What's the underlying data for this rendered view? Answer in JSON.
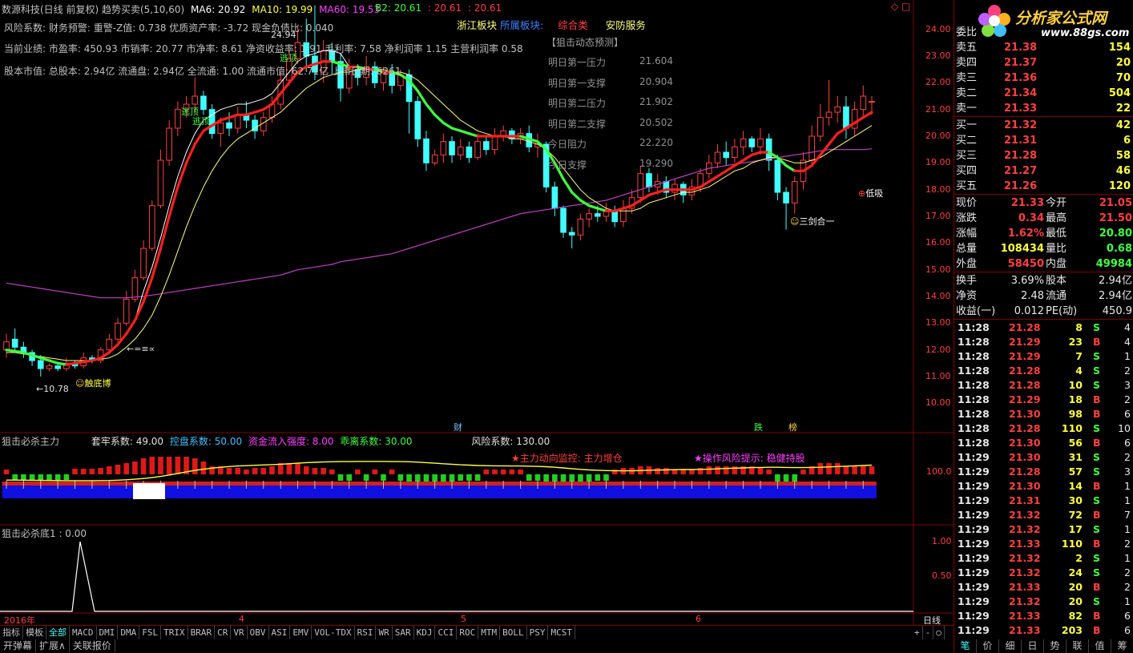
{
  "header": {
    "title": "数源科技(日线 前复权) 趋势买卖(5,10,60)",
    "ma6_label": "MA6: 20.92",
    "ma10_label": "MA10: 19.99",
    "ma60_label": "MA60: 19.53",
    "b2_label": "B2: 20.61",
    "b2_v2": ": 20.61",
    "b2_v3": ": 20.61",
    "region_label": "浙江板块",
    "sector_label": "所属板块:",
    "sector_value": "综合类",
    "sector_value2": "安防服务"
  },
  "info_lines": {
    "risk": "风险系数: 财务预警: 重警-Z值: 0.738 优质资产率: -3.72 现金负债比: 0.040",
    "perf": "当前业绩: 市盈率: 450.93 市销率: 20.77 市净率: 8.61 净资收益率: 1.91 毛利率: 7.58 净利润率 1.15 主营利润率 0.58",
    "cap": "股本市值: 总股本: 2.94亿 流通盘: 2.94亿 全流通: 1.00 流通市值: 62.71亿 上市日期: 6261"
  },
  "forecast": {
    "title": "【狙击动态预测】",
    "rows": [
      {
        "label": "明日第一压力",
        "value": "21.604"
      },
      {
        "label": "明日第一支撑",
        "value": "20.904"
      },
      {
        "label": "明日第二压力",
        "value": "21.902"
      },
      {
        "label": "明日第二支撑",
        "value": "20.502"
      },
      {
        "label": "今日阻力",
        "value": "22.220"
      },
      {
        "label": "今日支撑",
        "value": "19.290"
      }
    ]
  },
  "annotations": {
    "high_price": "24.94",
    "low_price": "←10.78",
    "escape_top": "逃顶",
    "bottom_buy": "低吸",
    "sword": "三剑合一",
    "bottom_fight": "触底博",
    "arrow_label": "←=≡∝",
    "marker_cai": "财",
    "marker_die": "跌",
    "marker_bang": "榜"
  },
  "price_axis": {
    "ticks": [
      "24.00",
      "23.00",
      "22.00",
      "21.00",
      "20.00",
      "19.00",
      "18.00",
      "17.00",
      "16.00",
      "15.00",
      "14.00",
      "13.00",
      "12.00",
      "11.00",
      "10.00"
    ]
  },
  "indicator1": {
    "title": "狙击必杀主力",
    "p1": "套牢系数: 49.00",
    "p2": "控盘系数: 50.00",
    "p3": "资金流入强度: 8.00",
    "p4": "乖离系数: 30.00",
    "p5": "风险系数: 130.00",
    "note1": "★主力动向监控: 主力增仓",
    "note2": "★操作风险提示: 稳健持股",
    "axis_value": "100.0"
  },
  "indicator2": {
    "title": "狙击必杀底1 : 0.00",
    "axis_top": "1.00",
    "axis_mid": "0.50"
  },
  "time_axis": {
    "labels": [
      "2016年",
      "4",
      "5",
      "6"
    ],
    "period": "日线"
  },
  "tabs": [
    "指标",
    "模板",
    "全部",
    "MACD",
    "DMI",
    "DMA",
    "FSL",
    "TRIX",
    "BRAR",
    "CR",
    "VR",
    "OBV",
    "ASI",
    "EMV",
    "VOL-TDX",
    "RSI",
    "WR",
    "SAR",
    "KDJ",
    "CCI",
    "ROC",
    "MTM",
    "BOLL",
    "PSY",
    "MCST"
  ],
  "tab_controls": [
    "+",
    "-",
    "○"
  ],
  "bottom_buttons": [
    "开弹幕",
    "扩展∧",
    "关联报价"
  ],
  "logo": {
    "text": "分析家公式网",
    "url": "www.88gs.com"
  },
  "quote": {
    "entrust_label": "委比",
    "asks": [
      {
        "label": "卖五",
        "price": "21.38",
        "vol": "154"
      },
      {
        "label": "卖四",
        "price": "21.37",
        "vol": "20"
      },
      {
        "label": "卖三",
        "price": "21.36",
        "vol": "70"
      },
      {
        "label": "卖二",
        "price": "21.34",
        "vol": "504"
      },
      {
        "label": "卖一",
        "price": "21.33",
        "vol": "22"
      }
    ],
    "bids": [
      {
        "label": "买一",
        "price": "21.32",
        "vol": "42"
      },
      {
        "label": "买二",
        "price": "21.31",
        "vol": "6"
      },
      {
        "label": "买三",
        "price": "21.28",
        "vol": "58"
      },
      {
        "label": "买四",
        "price": "21.27",
        "vol": "46"
      },
      {
        "label": "买五",
        "price": "21.26",
        "vol": "120"
      }
    ],
    "stats": [
      {
        "l1": "现价",
        "v1": "21.33",
        "c1": "up",
        "l2": "今开",
        "v2": "21.05",
        "c2": "up"
      },
      {
        "l1": "涨跌",
        "v1": "0.34",
        "c1": "up",
        "l2": "最高",
        "v2": "21.50",
        "c2": "up"
      },
      {
        "l1": "涨幅",
        "v1": "1.62%",
        "c1": "up",
        "l2": "最低",
        "v2": "20.80",
        "c2": "dn"
      },
      {
        "l1": "总量",
        "v1": "108434",
        "c1": "ye",
        "l2": "量比",
        "v2": "0.68",
        "c2": "dn"
      },
      {
        "l1": "外盘",
        "v1": "58450",
        "c1": "up",
        "l2": "内盘",
        "v2": "49984",
        "c2": "dn"
      }
    ],
    "stats2": [
      {
        "l1": "换手",
        "v1": "3.69%",
        "l2": "股本",
        "v2": "2.94亿"
      },
      {
        "l1": "净资",
        "v1": "2.48",
        "l2": "流通",
        "v2": "2.94亿"
      },
      {
        "l1": "收益(一)",
        "v1": "0.012",
        "l2": "PE(动)",
        "v2": "450.9"
      }
    ],
    "ticks": [
      {
        "t": "11:28",
        "p": "21.28",
        "v": "8",
        "s": "S",
        "n": "4"
      },
      {
        "t": "11:28",
        "p": "21.29",
        "v": "23",
        "s": "B",
        "n": "4"
      },
      {
        "t": "11:28",
        "p": "21.29",
        "v": "7",
        "s": "S",
        "n": "1"
      },
      {
        "t": "11:28",
        "p": "21.28",
        "v": "4",
        "s": "S",
        "n": "2"
      },
      {
        "t": "11:28",
        "p": "21.28",
        "v": "10",
        "s": "S",
        "n": "3"
      },
      {
        "t": "11:28",
        "p": "21.29",
        "v": "18",
        "s": "B",
        "n": "2"
      },
      {
        "t": "11:28",
        "p": "21.30",
        "v": "98",
        "s": "B",
        "n": "6"
      },
      {
        "t": "11:28",
        "p": "21.28",
        "v": "110",
        "s": "S",
        "n": "10"
      },
      {
        "t": "11:28",
        "p": "21.30",
        "v": "56",
        "s": "B",
        "n": "6"
      },
      {
        "t": "11:29",
        "p": "21.30",
        "v": "31",
        "s": "S",
        "n": "2"
      },
      {
        "t": "11:29",
        "p": "21.28",
        "v": "57",
        "s": "S",
        "n": "3"
      },
      {
        "t": "11:29",
        "p": "21.30",
        "v": "14",
        "s": "B",
        "n": "1"
      },
      {
        "t": "11:29",
        "p": "21.31",
        "v": "30",
        "s": "S",
        "n": "1"
      },
      {
        "t": "11:29",
        "p": "21.32",
        "v": "72",
        "s": "B",
        "n": "7"
      },
      {
        "t": "11:29",
        "p": "21.32",
        "v": "17",
        "s": "S",
        "n": "1"
      },
      {
        "t": "11:29",
        "p": "21.33",
        "v": "110",
        "s": "B",
        "n": "2"
      },
      {
        "t": "11:29",
        "p": "21.32",
        "v": "2",
        "s": "S",
        "n": "1"
      },
      {
        "t": "11:29",
        "p": "21.32",
        "v": "24",
        "s": "S",
        "n": "2"
      },
      {
        "t": "11:29",
        "p": "21.33",
        "v": "20",
        "s": "B",
        "n": "2"
      },
      {
        "t": "11:29",
        "p": "21.32",
        "v": "20",
        "s": "S",
        "n": "1"
      },
      {
        "t": "11:29",
        "p": "21.33",
        "v": "82",
        "s": "B",
        "n": "6"
      },
      {
        "t": "11:29",
        "p": "21.33",
        "v": "203",
        "s": "B",
        "n": "6"
      }
    ],
    "bottom_tabs": [
      "笔",
      "价",
      "细",
      "日",
      "势",
      "联",
      "值",
      "筹"
    ]
  },
  "chart_data": {
    "type": "candlestick",
    "price_range": [
      9.5,
      24.8
    ],
    "candles": [
      [
        12.0,
        12.3,
        11.7,
        12.6
      ],
      [
        12.4,
        12.1,
        11.9,
        12.8
      ],
      [
        12.1,
        11.9,
        11.7,
        12.3
      ],
      [
        11.9,
        11.6,
        11.4,
        12.0
      ],
      [
        11.6,
        11.3,
        11.0,
        11.8
      ],
      [
        11.3,
        11.4,
        11.2,
        11.5
      ],
      [
        11.4,
        11.3,
        11.2,
        11.5
      ],
      [
        11.3,
        11.5,
        11.2,
        11.7
      ],
      [
        11.5,
        11.4,
        11.3,
        11.6
      ],
      [
        11.4,
        11.7,
        11.3,
        11.9
      ],
      [
        11.7,
        11.6,
        11.5,
        11.8
      ],
      [
        11.6,
        12.0,
        11.5,
        12.1
      ],
      [
        12.0,
        12.4,
        11.9,
        12.6
      ],
      [
        12.4,
        13.0,
        12.3,
        13.2
      ],
      [
        13.0,
        13.9,
        12.9,
        14.2
      ],
      [
        13.9,
        14.7,
        13.8,
        15.0
      ],
      [
        14.7,
        15.8,
        14.6,
        16.1
      ],
      [
        15.8,
        17.4,
        15.7,
        17.6
      ],
      [
        17.4,
        19.1,
        17.3,
        19.5
      ],
      [
        19.1,
        20.3,
        18.9,
        20.6
      ],
      [
        20.3,
        21.0,
        20.0,
        21.3
      ],
      [
        21.0,
        21.2,
        20.7,
        21.5
      ],
      [
        21.2,
        21.5,
        20.9,
        22.2
      ],
      [
        21.5,
        21.0,
        20.8,
        21.7
      ],
      [
        21.0,
        20.1,
        19.9,
        21.2
      ],
      [
        20.1,
        20.5,
        19.6,
        20.7
      ],
      [
        20.5,
        20.3,
        20.0,
        20.9
      ],
      [
        20.3,
        20.8,
        20.1,
        21.1
      ],
      [
        20.8,
        20.6,
        20.3,
        21.3
      ],
      [
        20.6,
        20.2,
        19.9,
        20.8
      ],
      [
        20.2,
        20.7,
        20.0,
        20.9
      ],
      [
        20.7,
        21.2,
        20.5,
        21.5
      ],
      [
        21.2,
        22.1,
        21.0,
        22.4
      ],
      [
        22.1,
        22.9,
        21.9,
        23.2
      ],
      [
        22.9,
        23.5,
        22.7,
        24.1
      ],
      [
        23.5,
        23.0,
        22.4,
        24.4
      ],
      [
        23.0,
        22.4,
        22.1,
        24.9
      ],
      [
        22.4,
        23.2,
        22.0,
        23.6
      ],
      [
        23.2,
        22.8,
        22.3,
        23.5
      ],
      [
        22.8,
        21.8,
        21.3,
        23.1
      ],
      [
        21.8,
        22.5,
        21.6,
        22.9
      ],
      [
        22.5,
        22.2,
        21.9,
        22.7
      ],
      [
        22.2,
        22.6,
        21.9,
        23.0
      ],
      [
        22.6,
        22.0,
        21.8,
        22.8
      ],
      [
        22.0,
        22.4,
        21.7,
        22.6
      ],
      [
        22.4,
        21.9,
        21.6,
        22.7
      ],
      [
        21.9,
        22.3,
        21.7,
        22.5
      ],
      [
        22.3,
        21.3,
        20.1,
        22.5
      ],
      [
        21.3,
        19.9,
        19.6,
        21.5
      ],
      [
        19.9,
        19.0,
        18.7,
        20.2
      ],
      [
        19.0,
        19.3,
        18.9,
        19.5
      ],
      [
        19.3,
        19.8,
        19.0,
        20.1
      ],
      [
        19.8,
        19.3,
        19.0,
        20.0
      ],
      [
        19.3,
        19.6,
        19.1,
        19.9
      ],
      [
        19.6,
        19.2,
        19.0,
        19.8
      ],
      [
        19.2,
        19.8,
        19.1,
        20.1
      ],
      [
        19.8,
        19.5,
        19.3,
        20.0
      ],
      [
        19.5,
        20.0,
        19.3,
        20.3
      ],
      [
        20.0,
        20.2,
        19.8,
        20.4
      ],
      [
        20.2,
        19.9,
        19.7,
        20.3
      ],
      [
        19.9,
        20.1,
        19.7,
        20.3
      ],
      [
        20.1,
        19.6,
        19.4,
        20.4
      ],
      [
        19.6,
        19.7,
        19.2,
        20.1
      ],
      [
        19.7,
        18.1,
        17.9,
        19.8
      ],
      [
        18.1,
        17.3,
        17.0,
        18.3
      ],
      [
        17.3,
        16.4,
        16.2,
        17.4
      ],
      [
        16.4,
        16.3,
        15.8,
        16.6
      ],
      [
        16.3,
        16.9,
        16.1,
        17.1
      ],
      [
        16.9,
        17.1,
        16.6,
        17.3
      ],
      [
        17.1,
        17.0,
        16.8,
        17.4
      ],
      [
        17.0,
        17.2,
        16.8,
        17.5
      ],
      [
        17.2,
        16.8,
        16.6,
        17.4
      ],
      [
        16.8,
        17.3,
        16.6,
        17.6
      ],
      [
        17.3,
        17.7,
        17.1,
        18.0
      ],
      [
        17.7,
        18.6,
        17.5,
        18.9
      ],
      [
        18.6,
        18.1,
        17.9,
        18.8
      ],
      [
        18.1,
        18.3,
        17.8,
        18.6
      ],
      [
        18.3,
        17.9,
        17.7,
        18.5
      ],
      [
        17.9,
        18.2,
        17.6,
        18.4
      ],
      [
        18.2,
        17.8,
        17.5,
        18.3
      ],
      [
        17.8,
        18.1,
        17.6,
        18.4
      ],
      [
        18.1,
        18.6,
        17.9,
        18.8
      ],
      [
        18.6,
        19.0,
        18.4,
        19.3
      ],
      [
        19.0,
        19.4,
        18.8,
        19.7
      ],
      [
        19.4,
        19.2,
        18.9,
        19.8
      ],
      [
        19.2,
        19.6,
        19.0,
        19.9
      ],
      [
        19.6,
        19.9,
        19.3,
        20.2
      ],
      [
        19.9,
        19.6,
        19.4,
        20.0
      ],
      [
        19.6,
        19.9,
        19.3,
        20.3
      ],
      [
        19.9,
        19.1,
        18.7,
        20.1
      ],
      [
        19.1,
        17.9,
        17.6,
        19.3
      ],
      [
        17.9,
        17.5,
        16.5,
        18.1
      ],
      [
        17.5,
        18.3,
        17.1,
        18.5
      ],
      [
        18.3,
        19.1,
        18.0,
        19.4
      ],
      [
        19.1,
        20.0,
        18.9,
        20.4
      ],
      [
        20.0,
        20.7,
        19.8,
        21.2
      ],
      [
        20.7,
        20.9,
        20.4,
        22.1
      ],
      [
        20.9,
        21.1,
        20.5,
        21.5
      ],
      [
        21.1,
        20.3,
        19.9,
        21.5
      ],
      [
        20.3,
        21.0,
        20.0,
        21.3
      ],
      [
        21.0,
        21.5,
        20.7,
        21.9
      ],
      [
        21.3,
        21.3,
        20.8,
        21.5
      ]
    ],
    "ma_fast": [
      12.0,
      11.95,
      11.9,
      11.8,
      11.7,
      11.6,
      11.5,
      11.45,
      11.5,
      11.55,
      11.6,
      11.7,
      11.9,
      12.2,
      12.6,
      13.1,
      13.8,
      14.7,
      15.8,
      17.0,
      18.1,
      19.0,
      19.7,
      20.2,
      20.4,
      20.6,
      20.7,
      20.8,
      20.8,
      20.9,
      21.0,
      21.2,
      21.6,
      22.0,
      22.4,
      22.6,
      22.7,
      22.8,
      22.8,
      22.7,
      22.6,
      22.6,
      22.5,
      22.5,
      22.4,
      22.4,
      22.3,
      22.1,
      21.7,
      21.2,
      20.8,
      20.5,
      20.3,
      20.2,
      20.1,
      20.0,
      20.0,
      20.0,
      20.0,
      20.0,
      20.0,
      19.9,
      19.8,
      19.5,
      19.0,
      18.4,
      17.9,
      17.6,
      17.4,
      17.3,
      17.2,
      17.2,
      17.3,
      17.4,
      17.6,
      17.8,
      17.9,
      18.0,
      18.0,
      18.0,
      18.0,
      18.1,
      18.3,
      18.5,
      18.7,
      18.9,
      19.1,
      19.3,
      19.4,
      19.4,
      19.2,
      18.9,
      18.7,
      18.7,
      18.9,
      19.3,
      19.7,
      20.1,
      20.3,
      20.5,
      20.7,
      20.9
    ],
    "ma_mid": [
      11.9,
      11.9,
      11.85,
      11.8,
      11.75,
      11.7,
      11.65,
      11.6,
      11.6,
      11.6,
      11.6,
      11.65,
      11.7,
      11.85,
      12.1,
      12.4,
      12.8,
      13.3,
      14.0,
      14.8,
      15.7,
      16.6,
      17.4,
      18.1,
      18.7,
      19.2,
      19.6,
      19.9,
      20.1,
      20.3,
      20.5,
      20.7,
      20.9,
      21.2,
      21.5,
      21.8,
      22.0,
      22.2,
      22.3,
      22.4,
      22.4,
      22.5,
      22.5,
      22.5,
      22.5,
      22.4,
      22.4,
      22.3,
      22.1,
      21.8,
      21.5,
      21.2,
      20.9,
      20.6,
      20.4,
      20.2,
      20.1,
      20.0,
      20.0,
      19.9,
      19.9,
      19.8,
      19.7,
      19.5,
      19.2,
      18.8,
      18.4,
      18.0,
      17.7,
      17.5,
      17.3,
      17.2,
      17.2,
      17.2,
      17.3,
      17.5,
      17.6,
      17.7,
      17.8,
      17.9,
      17.9,
      18.0,
      18.1,
      18.3,
      18.5,
      18.7,
      18.8,
      19.0,
      19.1,
      19.2,
      19.2,
      19.1,
      19.0,
      19.0,
      19.1,
      19.2,
      19.4,
      19.6,
      19.8,
      20.0,
      20.2,
      20.4
    ],
    "ma_slow": [
      14.5,
      14.45,
      14.4,
      14.35,
      14.3,
      14.25,
      14.2,
      14.15,
      14.1,
      14.05,
      14.0,
      13.95,
      13.95,
      13.95,
      13.95,
      13.98,
      14.0,
      14.05,
      14.1,
      14.15,
      14.2,
      14.25,
      14.3,
      14.35,
      14.4,
      14.45,
      14.5,
      14.55,
      14.6,
      14.65,
      14.7,
      14.75,
      14.8,
      14.9,
      15.0,
      15.05,
      15.1,
      15.15,
      15.2,
      15.3,
      15.35,
      15.4,
      15.45,
      15.5,
      15.55,
      15.6,
      15.7,
      15.8,
      15.9,
      16.0,
      16.1,
      16.2,
      16.3,
      16.4,
      16.5,
      16.6,
      16.7,
      16.8,
      16.9,
      17.0,
      17.1,
      17.15,
      17.2,
      17.25,
      17.3,
      17.35,
      17.4,
      17.45,
      17.5,
      17.55,
      17.6,
      17.7,
      17.8,
      17.9,
      18.0,
      18.1,
      18.2,
      18.3,
      18.4,
      18.5,
      18.6,
      18.7,
      18.8,
      18.85,
      18.9,
      18.95,
      19.0,
      19.05,
      19.1,
      19.15,
      19.2,
      19.25,
      19.3,
      19.35,
      19.4,
      19.45,
      19.5,
      19.5,
      19.5,
      19.5,
      19.5,
      19.53
    ]
  }
}
